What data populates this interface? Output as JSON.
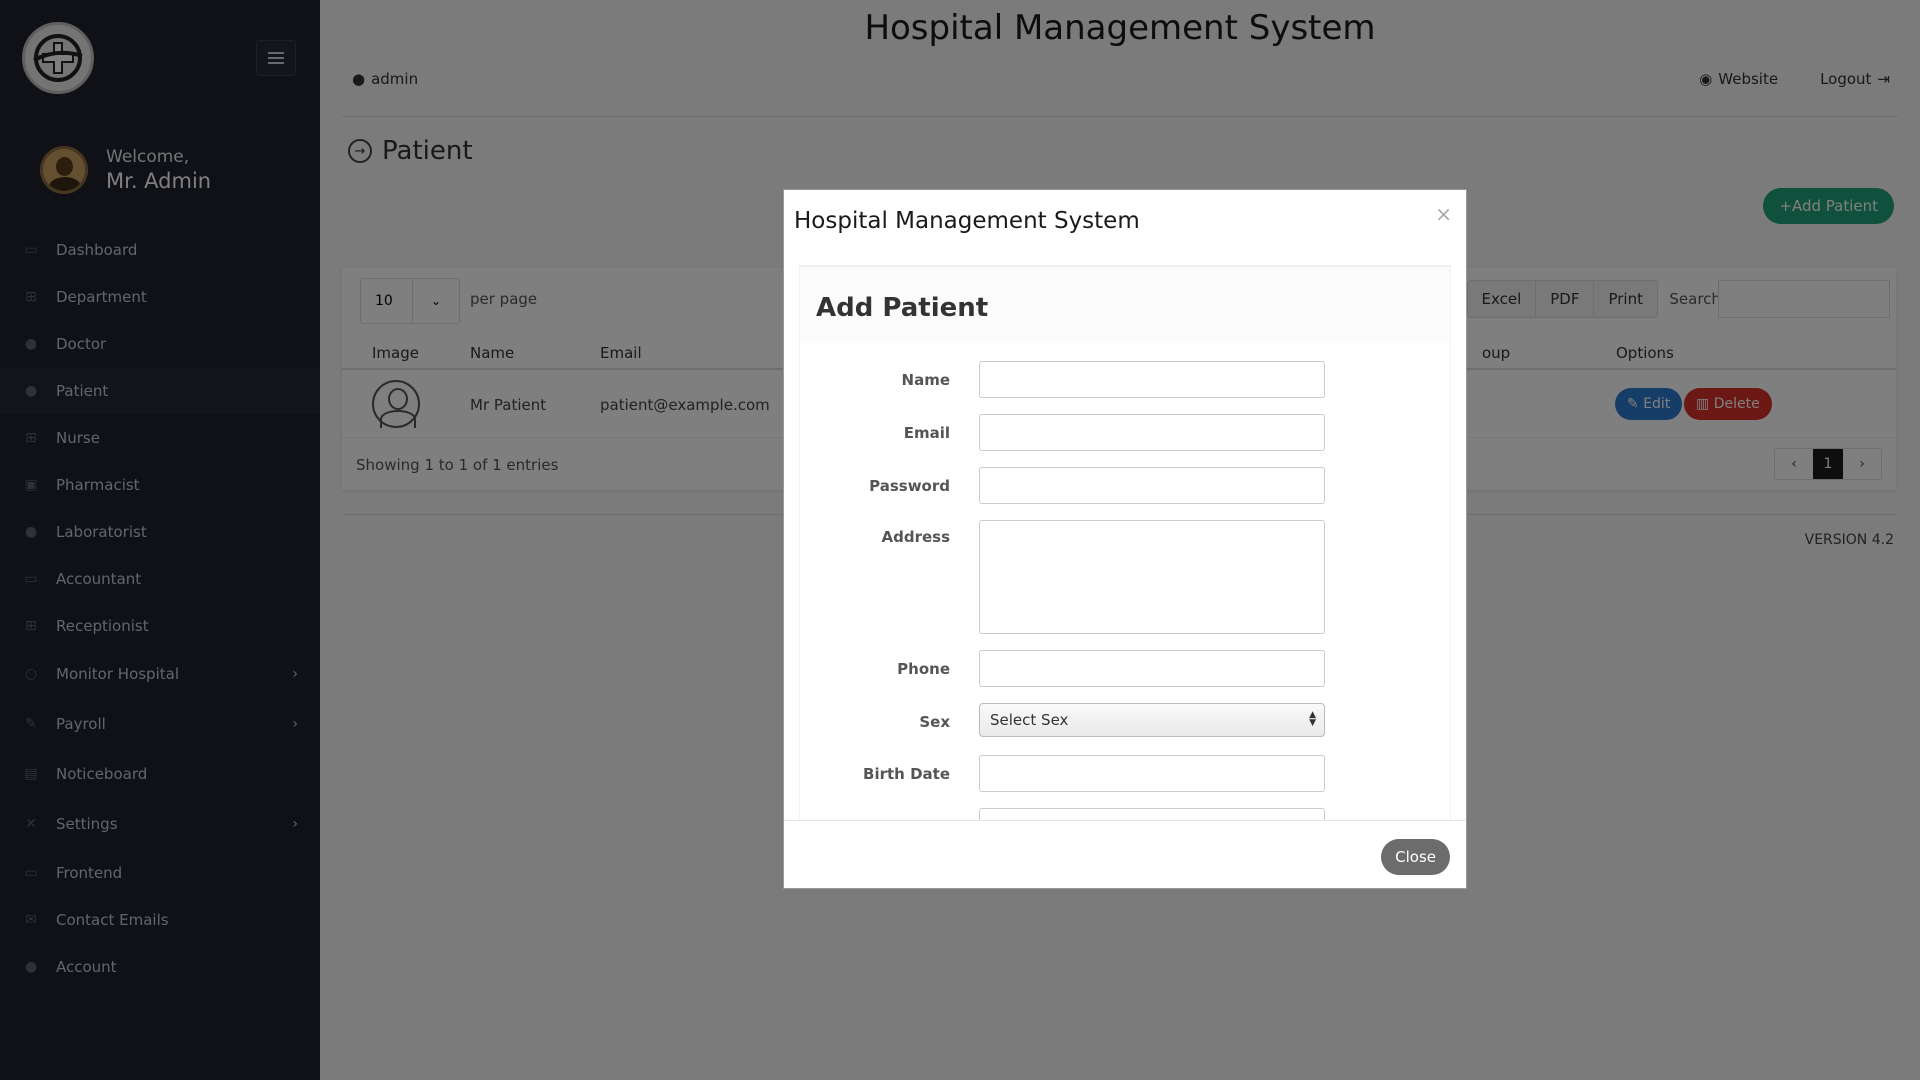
{
  "app": {
    "title": "Hospital Management System",
    "user": "admin",
    "website_label": "Website",
    "logout_label": "Logout"
  },
  "sidebar": {
    "welcome": "Welcome,",
    "name": "Mr. Admin",
    "items": [
      {
        "label": "Dashboard",
        "icon": "desktop-icon"
      },
      {
        "label": "Department",
        "icon": "sitemap-icon"
      },
      {
        "label": "Doctor",
        "icon": "user-md-icon"
      },
      {
        "label": "Patient",
        "icon": "user-icon"
      },
      {
        "label": "Nurse",
        "icon": "plus-square-icon"
      },
      {
        "label": "Pharmacist",
        "icon": "medkit-icon"
      },
      {
        "label": "Laboratorist",
        "icon": "user-icon"
      },
      {
        "label": "Accountant",
        "icon": "money-icon"
      },
      {
        "label": "Receptionist",
        "icon": "plus-square-icon"
      },
      {
        "label": "Monitor Hospital",
        "icon": "circle-icon"
      },
      {
        "label": "Payroll",
        "icon": "pencil-icon"
      },
      {
        "label": "Noticeboard",
        "icon": "clipboard-icon"
      },
      {
        "label": "Settings",
        "icon": "wrench-icon"
      },
      {
        "label": "Frontend",
        "icon": "laptop-icon"
      },
      {
        "label": "Contact Emails",
        "icon": "envelope-icon"
      },
      {
        "label": "Account",
        "icon": "user-icon"
      }
    ]
  },
  "page": {
    "title": "Patient",
    "add_button": "Add Patient",
    "per_page_value": "10",
    "per_page_label": "per page",
    "export": [
      "Excel",
      "PDF",
      "Print"
    ],
    "search_label": "Search:",
    "columns": [
      "Image",
      "Name",
      "Email",
      "oup",
      "Options"
    ],
    "row": {
      "name": "Mr Patient",
      "email": "patient@example.com"
    },
    "edit_label": "Edit",
    "delete_label": "Delete",
    "showing": "Showing 1 to 1 of 1 entries",
    "pager": {
      "prev": "‹",
      "current": "1",
      "next": "›"
    },
    "version": "VERSION 4.2"
  },
  "modal": {
    "title": "Hospital Management System",
    "close_x": "×",
    "form_title": "Add Patient",
    "fields": {
      "name": "Name",
      "email": "Email",
      "password": "Password",
      "address": "Address",
      "phone": "Phone",
      "sex": "Sex",
      "sex_value": "Select Sex",
      "birth_date": "Birth Date"
    },
    "close_button": "Close"
  },
  "colors": {
    "sidebar_bg": "#1f222c",
    "accent_green": "#1fa37a",
    "edit_blue": "#2b7bd0",
    "delete_red": "#d9322a"
  }
}
